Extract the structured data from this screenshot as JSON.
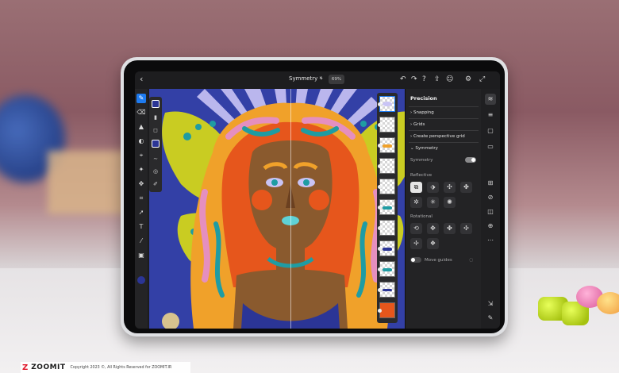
{
  "app": {
    "document_title": "Symmetry *",
    "zoom_level": "69%"
  },
  "topbar": {
    "back_icon": "chevron-left-icon",
    "icons": [
      "undo-icon",
      "redo-icon",
      "help-icon",
      "share-icon",
      "profile-icon",
      "settings-icon",
      "fullscreen-icon"
    ]
  },
  "left_toolbar": {
    "tools": [
      "brush-icon",
      "eraser-icon",
      "fill-icon",
      "smudge-icon",
      "selection-icon",
      "shape-icon",
      "transform-icon",
      "crop-icon",
      "select-icon",
      "text-icon",
      "eyedropper-icon",
      "image-icon"
    ],
    "active_tool": "brush-icon",
    "color": "#2b3596"
  },
  "panel": {
    "title": "Precision",
    "snapping": "Snapping",
    "grids": "Grids",
    "perspective": "Create perspective grid",
    "symmetry_section": "Symmetry",
    "symmetry_toggle_label": "Symmetry",
    "reflective_label": "Reflective",
    "rotational_label": "Rotational",
    "move_guides": "Move guides"
  },
  "colors": {
    "accent": "#1e7bf0",
    "panel_bg": "#232325",
    "canvas_purple": "#2b3596"
  },
  "watermark": {
    "logo": "ZOOMIT",
    "text": "Copyright 2023 ©, All Rights Reserved for ZOOMIT.IR"
  }
}
